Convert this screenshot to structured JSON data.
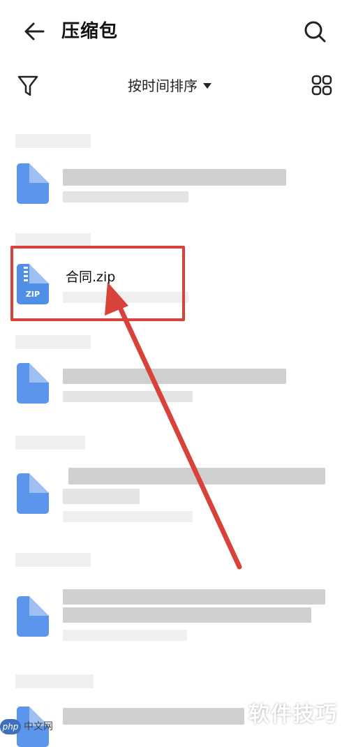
{
  "header": {
    "title": "压缩包",
    "back_icon": "arrow-left-icon",
    "search_icon": "search-icon"
  },
  "toolbar": {
    "filter_icon": "filter-icon",
    "sort_label": "按时间排序",
    "sort_caret_icon": "caret-down-icon",
    "view_icon": "grid-view-icon"
  },
  "files": [
    {
      "name": "",
      "blurred": true
    },
    {
      "name": "合同.zip",
      "blurred": false,
      "icon_label": "ZIP",
      "highlighted": true
    },
    {
      "name": "",
      "blurred": true
    },
    {
      "name": "",
      "blurred": true
    },
    {
      "name": "",
      "blurred": true
    },
    {
      "name": "",
      "blurred": true
    }
  ],
  "annotation": {
    "highlight_color": "#d9423a",
    "arrow_color": "#d9423a"
  },
  "colors": {
    "file_icon": "#5b95ec",
    "accent": "#d9423a"
  },
  "watermark": {
    "php_badge": "php",
    "php_site": "中文网",
    "brand": "软件技巧"
  }
}
